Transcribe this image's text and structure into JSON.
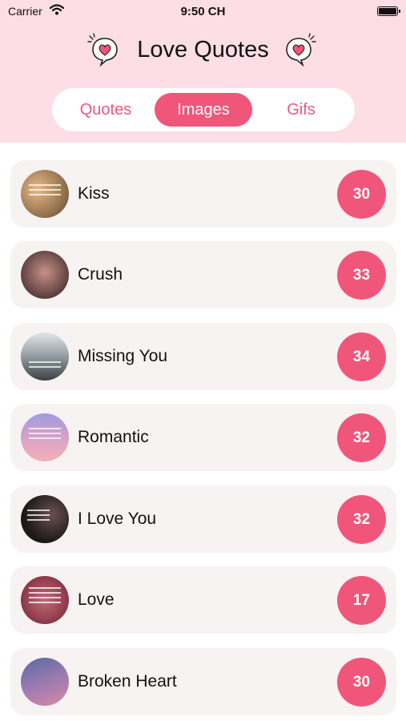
{
  "status": {
    "carrier": "Carrier",
    "time": "9:50 CH"
  },
  "header": {
    "title": "Love Quotes"
  },
  "tabs": [
    {
      "label": "Quotes",
      "selected": false
    },
    {
      "label": "Images",
      "selected": true
    },
    {
      "label": "Gifs",
      "selected": false
    }
  ],
  "categories": [
    {
      "name": "Kiss",
      "count": "30"
    },
    {
      "name": "Crush",
      "count": "33"
    },
    {
      "name": "Missing You",
      "count": "34"
    },
    {
      "name": "Romantic",
      "count": "32"
    },
    {
      "name": "I Love You",
      "count": "32"
    },
    {
      "name": "Love",
      "count": "17"
    },
    {
      "name": "Broken Heart",
      "count": "30"
    }
  ],
  "colors": {
    "accent": "#f0567a",
    "header_bg": "#fddde6",
    "card_bg": "#f8f3f3"
  }
}
